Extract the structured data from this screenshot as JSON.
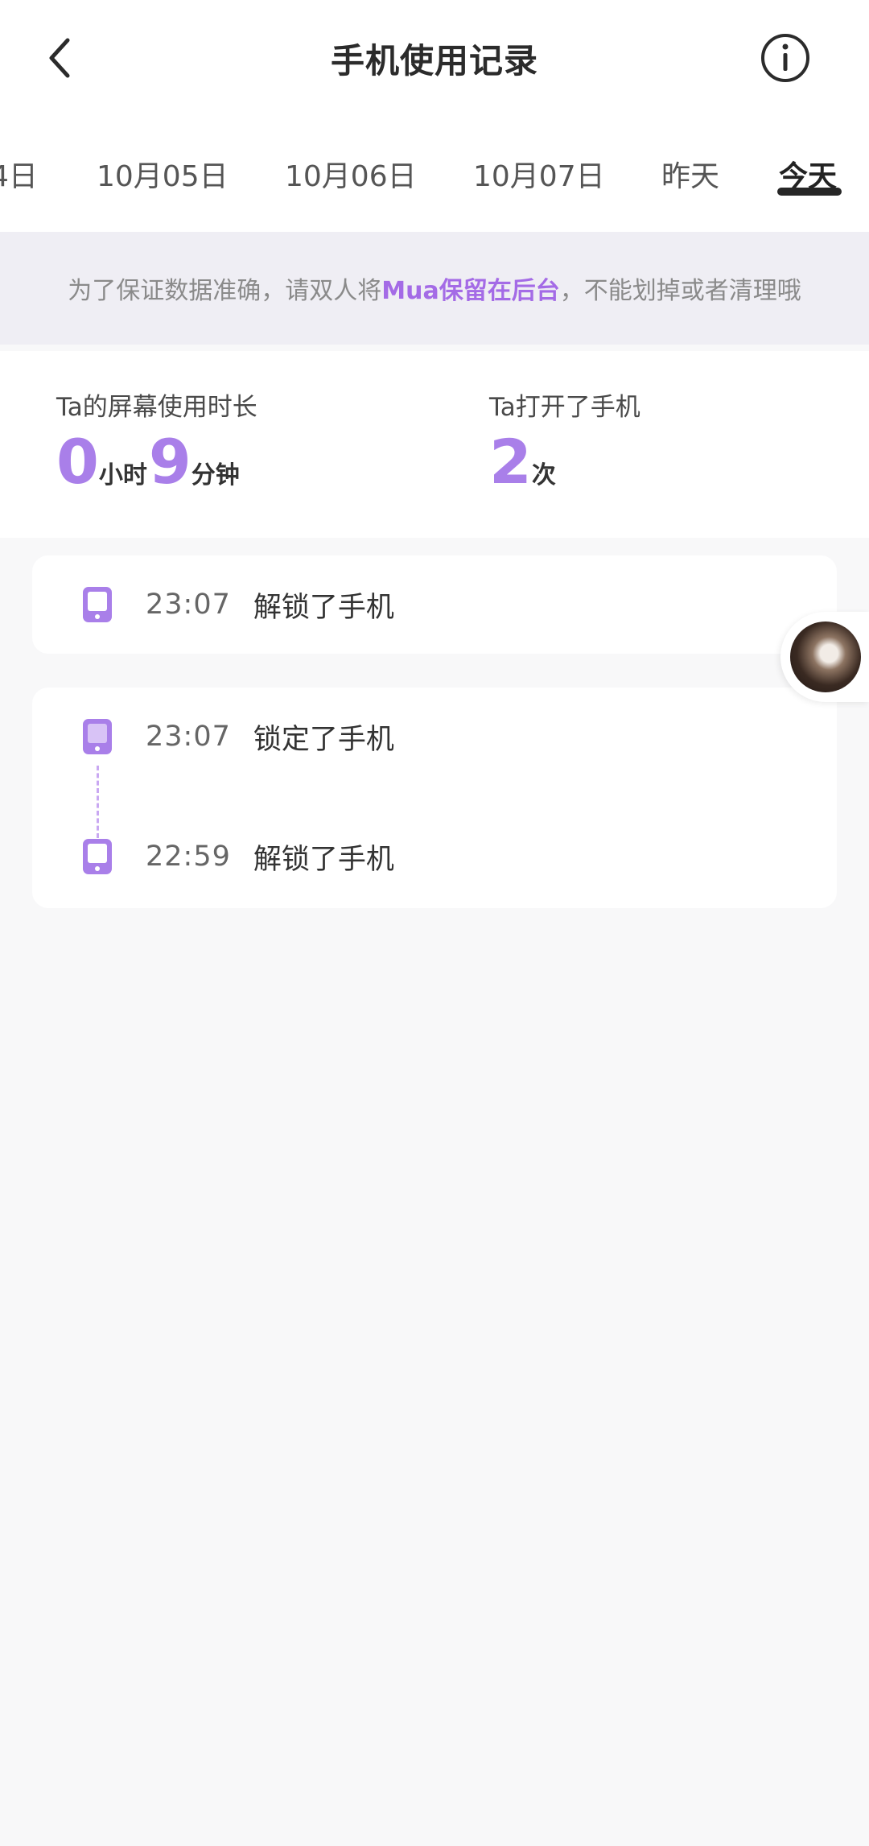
{
  "header": {
    "title": "手机使用记录",
    "back_icon": "chevron-left-icon",
    "info_icon": "info-circle-icon"
  },
  "tabs": [
    {
      "label": "4日"
    },
    {
      "label": "10月05日"
    },
    {
      "label": "10月06日"
    },
    {
      "label": "10月07日"
    },
    {
      "label": "昨天"
    },
    {
      "label": "今天",
      "active": true
    }
  ],
  "notice": {
    "prefix": "为了保证数据准确，请双人将",
    "highlight": "Mua保留在后台",
    "suffix": "，不能划掉或者清理哦"
  },
  "stats": {
    "screen_time": {
      "label": "Ta的屏幕使用时长",
      "hours": "0",
      "hours_unit": "小时",
      "minutes": "9",
      "minutes_unit": "分钟"
    },
    "unlocks": {
      "label": "Ta打开了手机",
      "count": "2",
      "count_unit": "次"
    }
  },
  "records": [
    {
      "time": "23:07",
      "text": "解锁了手机"
    },
    {
      "time": "23:07",
      "text": "锁定了手机"
    },
    {
      "time": "22:59",
      "text": "解锁了手机"
    }
  ],
  "colors": {
    "accent": "#a97fe9",
    "accent_text": "#a46be6",
    "notice_bg": "#efeef4",
    "page_bg": "#f8f8f9"
  }
}
